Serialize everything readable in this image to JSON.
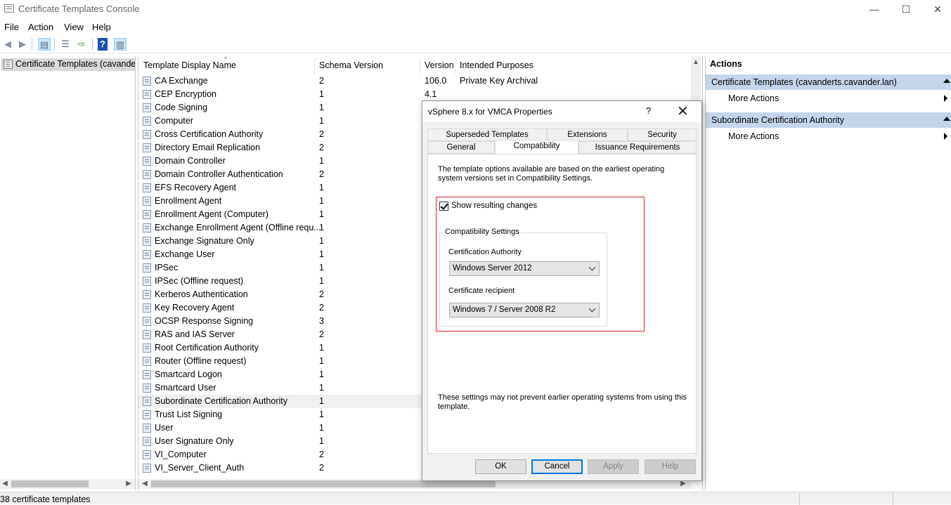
{
  "window": {
    "title": "Certificate Templates Console",
    "minimize": "—",
    "maximize": "☐",
    "close": "✕"
  },
  "menu": [
    "File",
    "Action",
    "View",
    "Help"
  ],
  "toolbar": {
    "icons": [
      "back-icon",
      "forward-icon",
      "show-hide-tree-icon",
      "properties-icon",
      "export-list-icon",
      "help-icon",
      "show-hide-action-pane-icon"
    ]
  },
  "tree": {
    "root_label": "Certificate Templates (cavanderts.cavander.lan)"
  },
  "list": {
    "columns": [
      "Template Display Name",
      "Schema Version",
      "Version",
      "Intended Purposes"
    ],
    "rows": [
      {
        "name": "CA Exchange",
        "schema": "2",
        "version": "106.0",
        "purposes": "Private Key Archival"
      },
      {
        "name": "CEP Encryption",
        "schema": "1",
        "version": "4.1",
        "purposes": ""
      },
      {
        "name": "Code Signing",
        "schema": "1",
        "version": "",
        "purposes": ""
      },
      {
        "name": "Computer",
        "schema": "1",
        "version": "",
        "purposes": ""
      },
      {
        "name": "Cross Certification Authority",
        "schema": "2",
        "version": "",
        "purposes": ""
      },
      {
        "name": "Directory Email Replication",
        "schema": "2",
        "version": "",
        "purposes": ""
      },
      {
        "name": "Domain Controller",
        "schema": "1",
        "version": "",
        "purposes": ""
      },
      {
        "name": "Domain Controller Authentication",
        "schema": "2",
        "version": "",
        "purposes": ""
      },
      {
        "name": "EFS Recovery Agent",
        "schema": "1",
        "version": "",
        "purposes": ""
      },
      {
        "name": "Enrollment Agent",
        "schema": "1",
        "version": "",
        "purposes": ""
      },
      {
        "name": "Enrollment Agent (Computer)",
        "schema": "1",
        "version": "",
        "purposes": ""
      },
      {
        "name": "Exchange Enrollment Agent (Offline requ...",
        "schema": "1",
        "version": "",
        "purposes": ""
      },
      {
        "name": "Exchange Signature Only",
        "schema": "1",
        "version": "",
        "purposes": ""
      },
      {
        "name": "Exchange User",
        "schema": "1",
        "version": "",
        "purposes": ""
      },
      {
        "name": "IPSec",
        "schema": "1",
        "version": "",
        "purposes": ""
      },
      {
        "name": "IPSec (Offline request)",
        "schema": "1",
        "version": "",
        "purposes": ""
      },
      {
        "name": "Kerberos Authentication",
        "schema": "2",
        "version": "",
        "purposes": ""
      },
      {
        "name": "Key Recovery Agent",
        "schema": "2",
        "version": "",
        "purposes": ""
      },
      {
        "name": "OCSP Response Signing",
        "schema": "3",
        "version": "",
        "purposes": ""
      },
      {
        "name": "RAS and IAS Server",
        "schema": "2",
        "version": "",
        "purposes": ""
      },
      {
        "name": "Root Certification Authority",
        "schema": "1",
        "version": "",
        "purposes": ""
      },
      {
        "name": "Router (Offline request)",
        "schema": "1",
        "version": "",
        "purposes": ""
      },
      {
        "name": "Smartcard Logon",
        "schema": "1",
        "version": "",
        "purposes": ""
      },
      {
        "name": "Smartcard User",
        "schema": "1",
        "version": "",
        "purposes": ""
      },
      {
        "name": "Subordinate Certification Authority",
        "schema": "1",
        "version": "",
        "purposes": "",
        "selected": true
      },
      {
        "name": "Trust List Signing",
        "schema": "1",
        "version": "",
        "purposes": ""
      },
      {
        "name": "User",
        "schema": "1",
        "version": "",
        "purposes": ""
      },
      {
        "name": "User Signature Only",
        "schema": "1",
        "version": "",
        "purposes": ""
      },
      {
        "name": "VI_Computer",
        "schema": "2",
        "version": "",
        "purposes": ""
      },
      {
        "name": "VI_Server_Client_Auth",
        "schema": "2",
        "version": "",
        "purposes": ""
      }
    ]
  },
  "actions": {
    "header": "Actions",
    "section1": "Certificate Templates (cavanderts.cavander.lan)",
    "section1_more": "More Actions",
    "section2": "Subordinate Certification Authority",
    "section2_more": "More Actions"
  },
  "status": {
    "text": "38 certificate templates"
  },
  "dialog": {
    "title": "vSphere 8.x for VMCA Properties",
    "help": "?",
    "close": "✕",
    "tabs_row1": [
      "Superseded Templates",
      "Extensions",
      "Security"
    ],
    "tabs_row2": [
      "General",
      "Compatibility",
      "Issuance Requirements"
    ],
    "active_tab": "Compatibility",
    "intro": "The template options available are based on the earliest operating system versions set in Compatibility Settings.",
    "show_changes_label": "Show resulting changes",
    "show_changes_checked": true,
    "group_label": "Compatibility Settings",
    "ca_label": "Certification Authority",
    "ca_value": "Windows Server 2012",
    "recipient_label": "Certificate recipient",
    "recipient_value": "Windows 7 / Server 2008 R2",
    "footer_note": "These settings may not prevent earlier operating systems from using this template.",
    "buttons": {
      "ok": "OK",
      "cancel": "Cancel",
      "apply": "Apply",
      "help": "Help"
    }
  }
}
